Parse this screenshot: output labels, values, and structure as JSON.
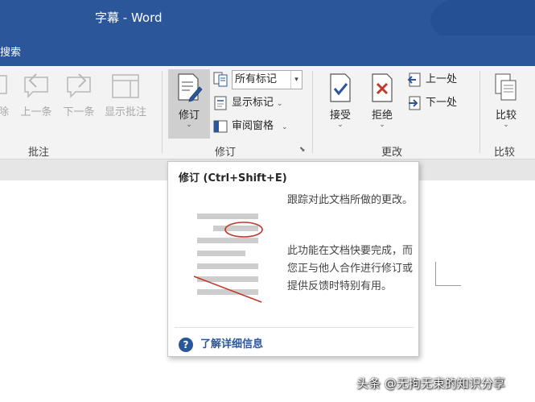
{
  "window": {
    "title": "字幕  -  Word"
  },
  "tabbar": {
    "search_label": "搜索"
  },
  "ribbon": {
    "comments_group": {
      "label": "批注",
      "delete_label": "除",
      "prev_label": "上一条",
      "next_label": "下一条",
      "show_label": "显示批注"
    },
    "tracking_group": {
      "label": "修订",
      "track_changes_label": "修订",
      "markup_select_value": "所有标记",
      "show_markup_label": "显示标记",
      "reviewing_pane_label": "审阅窗格"
    },
    "changes_group": {
      "label": "更改",
      "accept_label": "接受",
      "reject_label": "拒绝",
      "previous_label": "上一处",
      "next_label": "下一处"
    },
    "compare_group": {
      "label": "比较",
      "compare_label": "比较"
    }
  },
  "tooltip": {
    "title": "修订 (Ctrl+Shift+E)",
    "desc1": "跟踪对此文档所做的更改。",
    "desc2": "此功能在文档快要完成，而您正与他人合作进行修订或提供反馈时特别有用。",
    "help_label": "了解详细信息"
  },
  "watermark": {
    "text": "头条 @无拘无束的知识分享"
  },
  "colors": {
    "accent": "#2b579a",
    "ribbon_bg": "#f3f3f3",
    "selected": "#cfcfcf",
    "markup_red": "#c0392b"
  }
}
